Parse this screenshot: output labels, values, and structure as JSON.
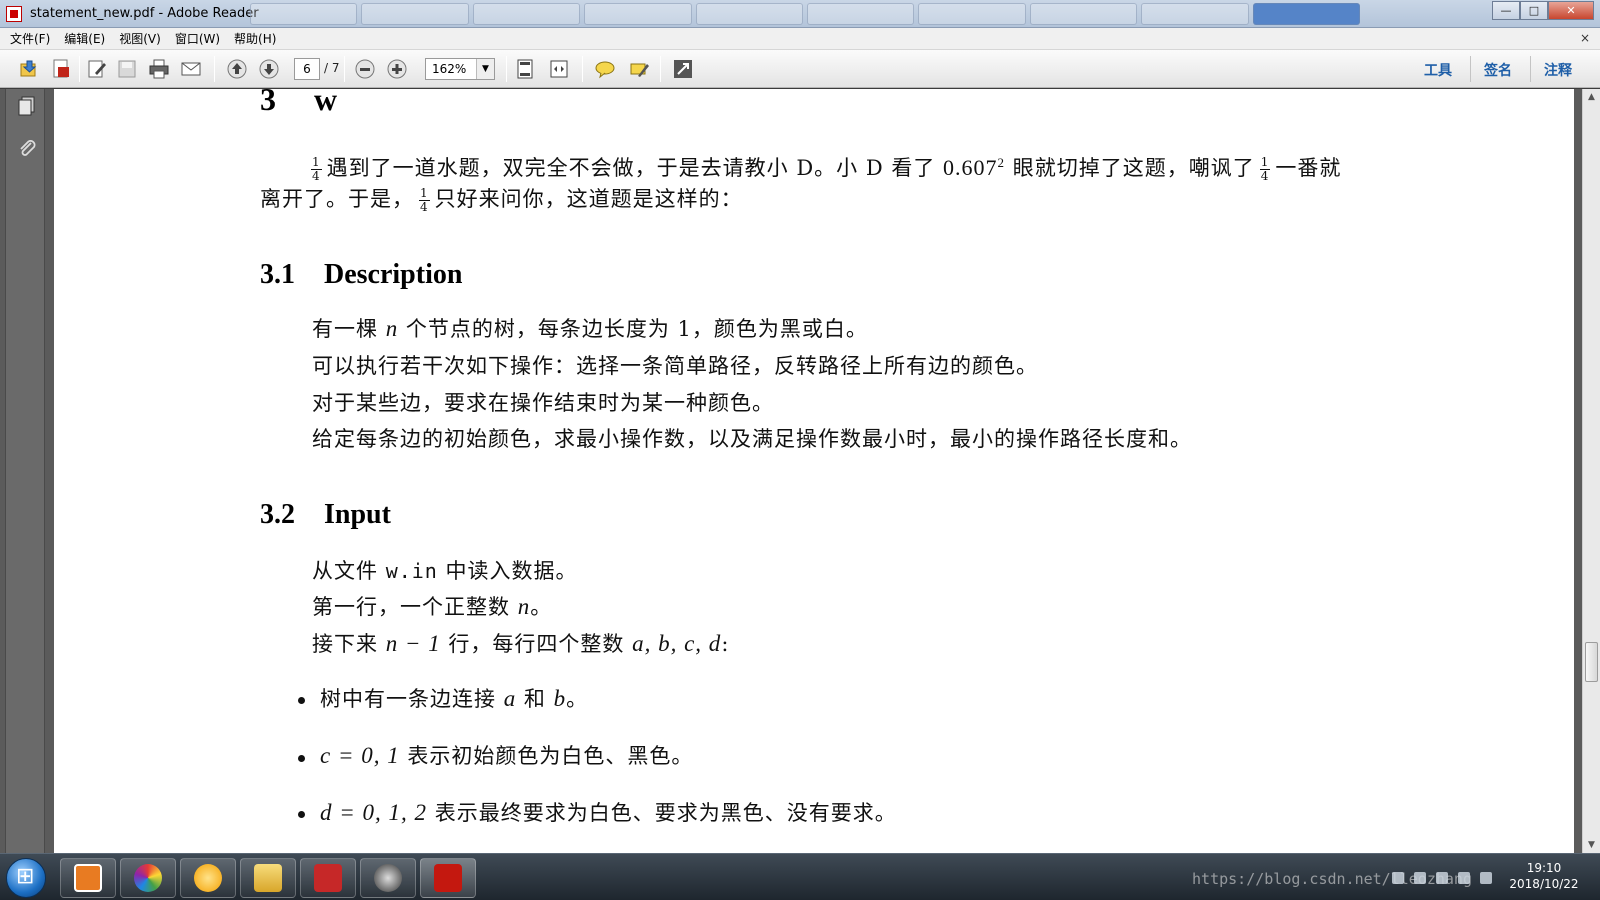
{
  "window": {
    "title": "statement_new.pdf - Adobe Reader",
    "controls": {
      "minimize": "—",
      "maximize": "□",
      "close": "✕"
    }
  },
  "menu": {
    "items": [
      "文件(F)",
      "编辑(E)",
      "视图(V)",
      "窗口(W)",
      "帮助(H)"
    ],
    "close_glyph": "×"
  },
  "toolbar": {
    "page_current": "6",
    "page_total": "/ 7",
    "zoom": "162%",
    "right_tools": [
      "工具",
      "签名",
      "注释"
    ]
  },
  "document": {
    "section": {
      "number": "3",
      "title": "w"
    },
    "intro": {
      "line1_a": "遇到了一道水题，双完全不会做，于是去请教小 D。小 D 看了",
      "number": "0.607",
      "exponent": "2",
      "line1_b": "眼就切掉了这题，嘲讽了",
      "line1_c": "一番就",
      "line2_a": "离开了。于是，",
      "line2_b": "只好来问你，这道题是这样的：",
      "frac_num": "1",
      "frac_den": "4"
    },
    "description": {
      "number": "3.1",
      "title": "Description",
      "line1_a": "有一棵",
      "line1_var": "n",
      "line1_b": "个节点的树，每条边长度为 1，颜色为黑或白。",
      "line2": "可以执行若干次如下操作：选择一条简单路径，反转路径上所有边的颜色。",
      "line3": "对于某些边，要求在操作结束时为某一种颜色。",
      "line4": "给定每条边的初始颜色，求最小操作数，以及满足操作数最小时，最小的操作路径长度和。"
    },
    "input": {
      "number": "3.2",
      "title": "Input",
      "line1_a": "从文件",
      "line1_file": "w.in",
      "line1_b": "中读入数据。",
      "line2_a": "第一行，一个正整数",
      "line2_var": "n",
      "line2_b": "。",
      "line3_a": "接下来",
      "line3_math": "n − 1",
      "line3_b": "行，每行四个整数",
      "line3_vars": "a, b, c, d",
      "line3_c": ":",
      "bullets": [
        {
          "a": "树中有一条边连接",
          "v1": "a",
          "b": "和",
          "v2": "b",
          "c": "。"
        },
        {
          "math": "c = 0, 1",
          "text": "表示初始颜色为白色、黑色。"
        },
        {
          "math": "d = 0, 1, 2",
          "text": "表示最终要求为白色、要求为黑色、没有要求。"
        }
      ]
    }
  },
  "taskbar": {
    "watermark": "https://blog.csdn.net/lleozhang",
    "time": "19:10",
    "date": "2018/10/22"
  }
}
